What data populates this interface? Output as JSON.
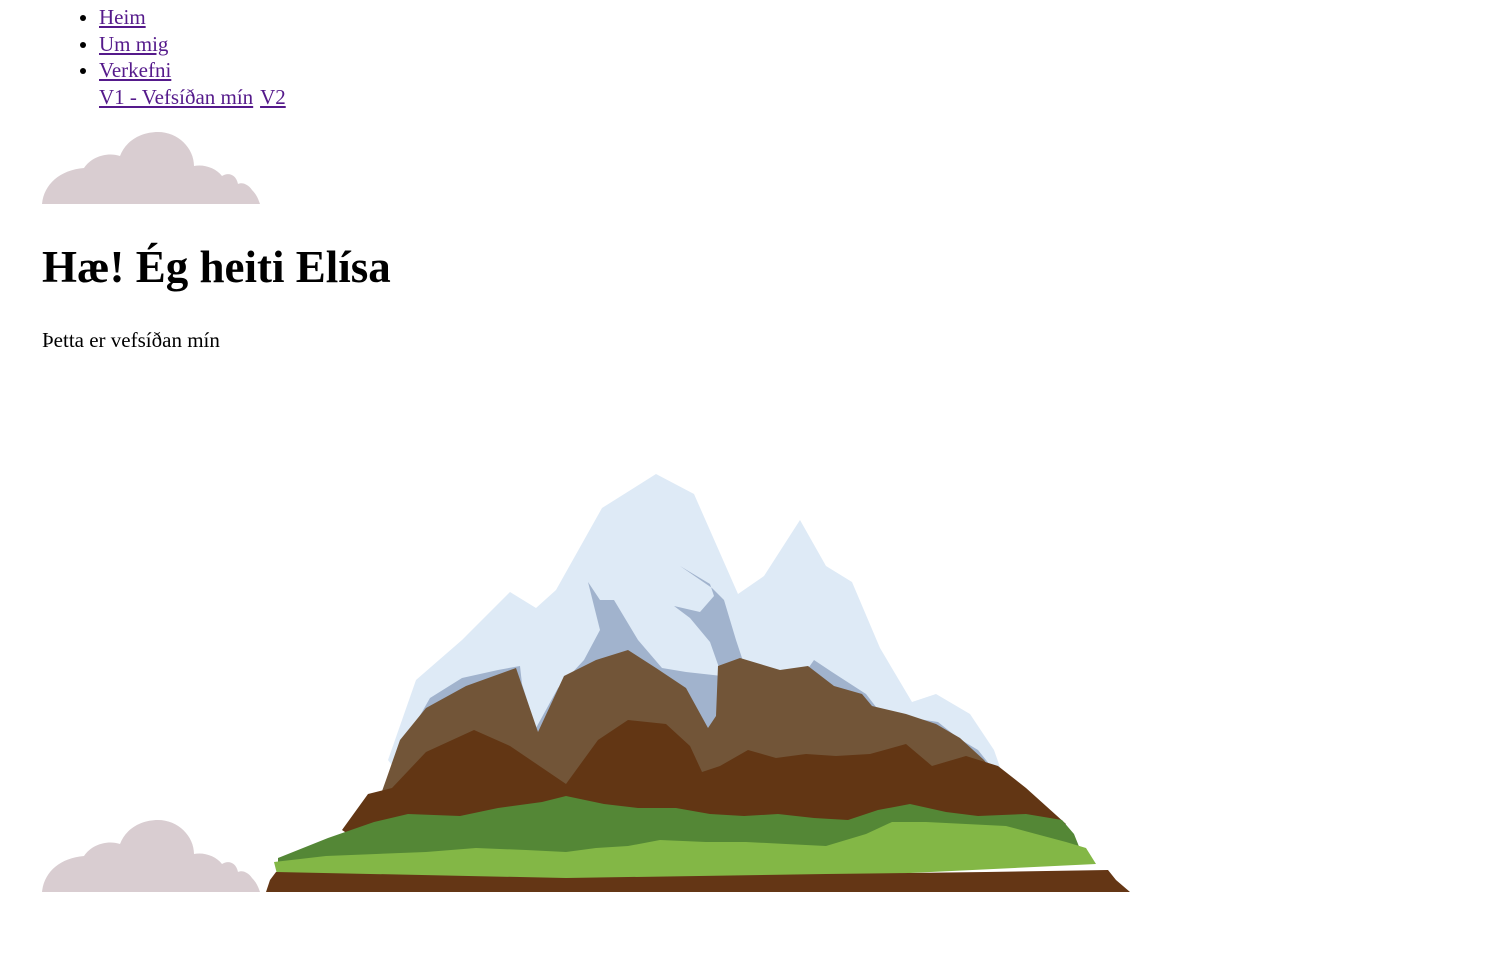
{
  "nav": {
    "items": [
      {
        "label": "Heim"
      },
      {
        "label": "Um mig"
      },
      {
        "label": "Verkefni"
      }
    ],
    "subitems": [
      {
        "label": "V1 - Vefsíðan mín"
      },
      {
        "label": "V2"
      }
    ]
  },
  "main": {
    "title": "Hæ! Ég heiti Elísa",
    "subtitle": "Þetta er vefsíðan mín"
  },
  "images": {
    "cloud_top": "cloud-image",
    "cloud_bottom": "cloud-image",
    "mountain": "mountain-image"
  },
  "colors": {
    "link": "#551a8b",
    "cloud": "#d9cdd1",
    "snow": "#deeaf6",
    "snow_shadow": "#a1b3cd",
    "rock_light": "#725538",
    "rock_dark": "#623614",
    "grass_dark": "#548736",
    "grass_light": "#83b746",
    "soil": "#643615"
  }
}
